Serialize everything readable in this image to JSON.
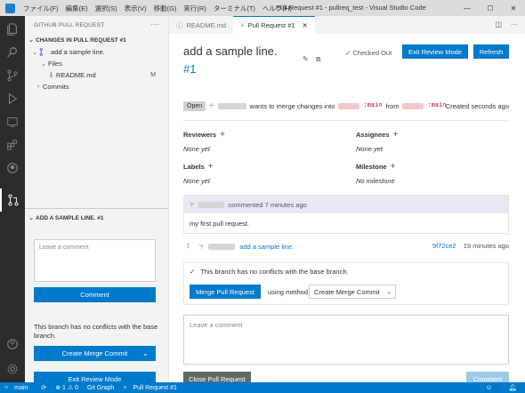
{
  "titlebar": {
    "menu": [
      "ファイル(F)",
      "編集(E)",
      "選択(S)",
      "表示(V)",
      "移動(G)",
      "実行(R)",
      "ターミナル(T)",
      "ヘルプ(H)"
    ],
    "title": "Pull Request #1 - pullreq_test - Visual Studio Code"
  },
  "sidebar": {
    "header": "GITHUB PULL REQUEST",
    "section_title": "CHANGES IN PULL REQUEST #1",
    "tree": {
      "pr_item": "add a sample line.",
      "files_label": "Files",
      "file_name": "README.md",
      "file_badge": "M",
      "commits_label": "Commits"
    },
    "pr_panel": {
      "title": "ADD A SAMPLE LINE. #1",
      "comment_placeholder": "Leave a comment",
      "comment_button": "Comment",
      "message": "This branch has no conflicts with the base branch.",
      "create_merge_button": "Create Merge Commit",
      "exit_review_button": "Exit Review Mode"
    }
  },
  "editor": {
    "tabs": [
      {
        "label": "README.md"
      },
      {
        "label": "Pull Request #1"
      }
    ],
    "pr": {
      "title": "add a sample line.",
      "number": "#1",
      "checked_out": "Checked Out",
      "exit_review_button": "Exit Review Mode",
      "refresh_button": "Refresh",
      "status_badge": "Open",
      "wants_to_merge": "wants to merge changes into",
      "base_branch": ":main",
      "from_word": "from",
      "head_branch": ":main",
      "created": "Created seconds ago",
      "reviewers_label": "Reviewers",
      "reviewers_value": "None yet",
      "assignees_label": "Assignees",
      "assignees_value": "None yet",
      "labels_label": "Labels",
      "labels_value": "None yet",
      "milestone_label": "Milestone",
      "milestone_value": "No milestone",
      "comment_meta": "commented 7 minutes ago",
      "comment_body": "my first pull request.",
      "commit_message": "add a sample line.",
      "commit_hash": "9f72ce2",
      "commit_time": "19 minutes ago",
      "merge_message": "This branch has no conflicts with the base branch.",
      "merge_button": "Merge Pull Request",
      "using_method": "using method",
      "merge_method": "Create Merge Commit",
      "comment_placeholder": "Leave a comment",
      "close_button": "Close Pull Request",
      "comment_button": "Comment"
    }
  },
  "statusbar": {
    "branch": "main",
    "problems": "⊗ 1 ⚠ 0",
    "git_graph": "Git Graph",
    "pr": "Pull Request #1"
  },
  "colors": {
    "accent": "#007acc",
    "activity_bar": "#2c2c2c",
    "sidebar_bg": "#f3f3f3"
  }
}
